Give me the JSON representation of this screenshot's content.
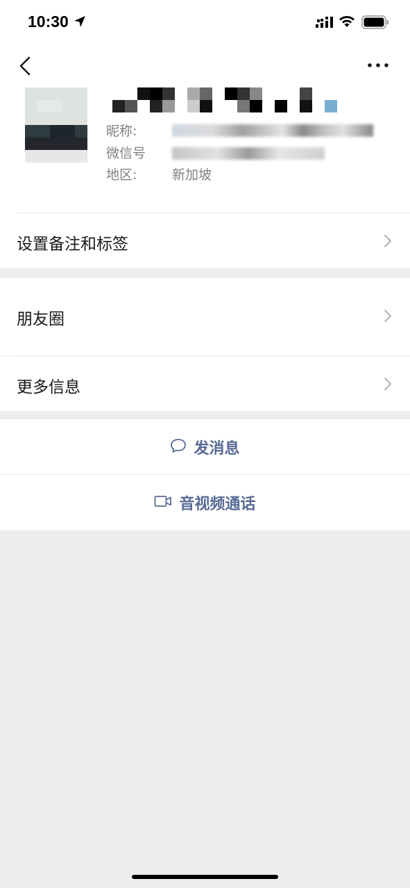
{
  "status_bar": {
    "time": "10:30",
    "icons": [
      "location-arrow-icon",
      "cellular-signal-icon",
      "wifi-icon",
      "battery-icon"
    ]
  },
  "nav": {
    "back_icon": "chevron-left-icon",
    "more_icon": "more-dots-icon"
  },
  "profile": {
    "nickname_label": "昵称:",
    "wechat_id_label": "微信号",
    "region_label": "地区:",
    "region_value": "新加坡"
  },
  "menu": {
    "remark_tags": "设置备注和标签",
    "moments": "朋友圈",
    "more_info": "更多信息"
  },
  "actions": {
    "send_message": "发消息",
    "video_call": "音视频通话"
  },
  "colors": {
    "link_blue": "#576b95",
    "background_gray": "#ededed",
    "secondary_text": "#7f7f7f",
    "chevron_gray": "#b2b2b2"
  }
}
